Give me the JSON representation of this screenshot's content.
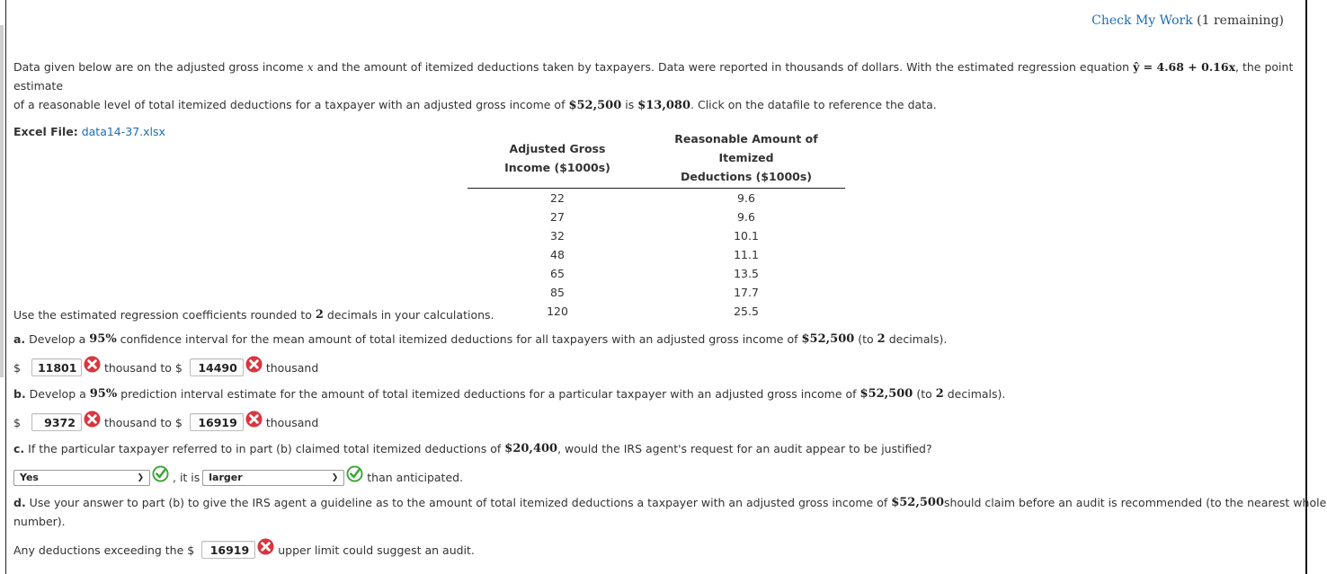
{
  "header": {
    "check_my_work_label": "Check My Work",
    "remaining": "(1 remaining)"
  },
  "intro": {
    "line1_a": "Data given below are on the adjusted gross income ",
    "var_x": "x",
    "line1_b": " and the amount of itemized deductions taken by taxpayers. Data were reported in thousands of dollars. With the estimated regression equation ",
    "equation": "ŷ = 4.68 + 0.16x",
    "line1_c": ", the point estimate",
    "line2_a": "of a reasonable level of total itemized deductions for a taxpayer with an adjusted gross income of ",
    "income": "$52,500",
    "line2_b": " is ",
    "estimate": "$13,080",
    "line2_c": ". Click on the datafile to reference the data."
  },
  "excel": {
    "label": "Excel File:",
    "file": "data14-37.xlsx"
  },
  "table": {
    "headers": [
      [
        "Adjusted Gross",
        "Income ($1000s)"
      ],
      [
        "Reasonable Amount of Itemized",
        "Deductions ($1000s)"
      ]
    ],
    "rows": [
      [
        "22",
        "9.6"
      ],
      [
        "27",
        "9.6"
      ],
      [
        "32",
        "10.1"
      ],
      [
        "48",
        "11.1"
      ],
      [
        "65",
        "13.5"
      ],
      [
        "85",
        "17.7"
      ],
      [
        "120",
        "25.5"
      ]
    ]
  },
  "instruction": {
    "a": "Use the estimated regression coefficients rounded to ",
    "num": "2",
    "b": " decimals in your calculations."
  },
  "part_a": {
    "label": "a.",
    "text1": " Develop a ",
    "pct": "95%",
    "text2": " confidence interval for the mean amount of total itemized deductions for all taxpayers with an adjusted gross income of ",
    "income": "$52,500",
    "text3": " (to ",
    "dec": "2",
    "text4": " decimals).",
    "dollar": "$",
    "lower": "11801",
    "mid": "thousand to $",
    "upper": "14490",
    "unit": "thousand",
    "lower_status": "incorrect",
    "upper_status": "incorrect"
  },
  "part_b": {
    "label": "b.",
    "text1": " Develop a ",
    "pct": "95%",
    "text2": " prediction interval estimate for the amount of total itemized deductions for a particular taxpayer with an adjusted gross income of ",
    "income": "$52,500",
    "text3": " (to ",
    "dec": "2",
    "text4": " decimals).",
    "dollar": "$",
    "lower": "9372",
    "mid": "thousand to $",
    "upper": "16919",
    "unit": "thousand",
    "lower_status": "incorrect",
    "upper_status": "incorrect"
  },
  "part_c": {
    "label": "c.",
    "text1": " If the particular taxpayer referred to in part (b) claimed total itemized deductions of ",
    "amount": "$20,400",
    "text2": ", would the IRS agent's request for an audit appear to be justified?",
    "select1": "Yes",
    "mid": ", it is",
    "select2": "larger",
    "tail": "than anticipated.",
    "select1_status": "correct",
    "select2_status": "correct"
  },
  "part_d": {
    "label": "d.",
    "text1": " Use your answer to part (b) to give the IRS agent a guideline as to the amount of total itemized deductions a taxpayer with an adjusted gross income of ",
    "income": "$52,500",
    "text2": " should claim before an audit is recommended (to the nearest whole",
    "text3": "number).",
    "prefix": "Any deductions exceeding the $",
    "value": "16919",
    "suffix": "upper limit could suggest an audit.",
    "status": "incorrect"
  },
  "colors": {
    "link": "#1a6eb5",
    "incorrect": "#d9363e",
    "correct": "#3aa535"
  }
}
